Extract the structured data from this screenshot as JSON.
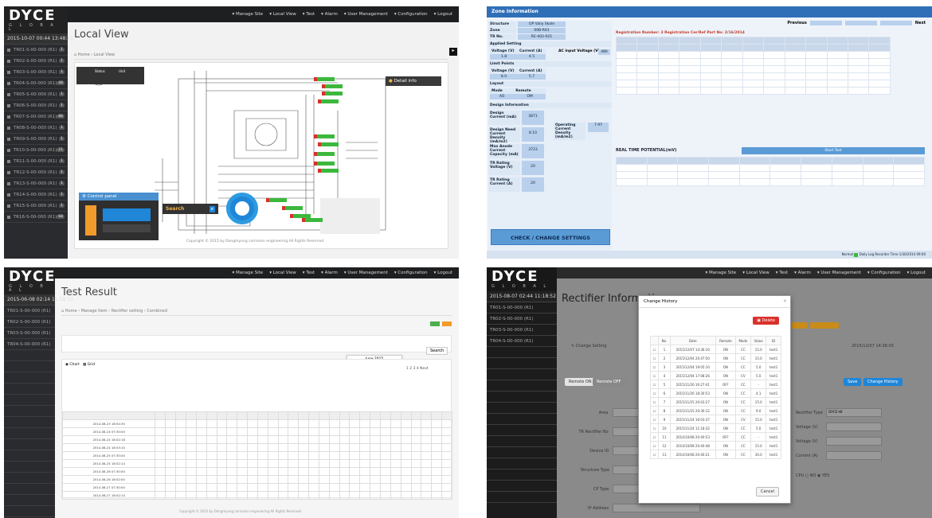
{
  "brand": {
    "name": "DYCE",
    "tagline": "G L O B A L"
  },
  "colors": {
    "sidebar": "#2a2b2e",
    "accent_blue": "#1f86d8",
    "panel_blue": "#5b9bd5",
    "orange": "#f29b2b",
    "red": "#d9302a",
    "green": "#4cae4c",
    "marker_green": "#3cb83c"
  },
  "p1": {
    "clock": "2015-10-07 00:44 13:48:21",
    "title": "Local View",
    "breadcrumb": [
      "Home",
      "Local View"
    ],
    "nav": [
      "Manage Site",
      "Local View",
      "Test",
      "Alarm",
      "User Management",
      "Configuration",
      "Logout"
    ],
    "sidebar": [
      {
        "label": "TR01-S-00-000 (R1)",
        "badge": "1"
      },
      {
        "label": "TR02-S-00-000 (R1)",
        "badge": "1"
      },
      {
        "label": "TR03-S-00-000 (R1)",
        "badge": "1"
      },
      {
        "label": "TR04-S-00-000 (R1)",
        "badge": "48"
      },
      {
        "label": "TR05-S-00-000 (R1)",
        "badge": "1"
      },
      {
        "label": "TR06-S-00-000 (R1)",
        "badge": "1"
      },
      {
        "label": "TR07-S-00-000 (R1)",
        "badge": "88"
      },
      {
        "label": "TR08-S-00-000 (R1)",
        "badge": "1"
      },
      {
        "label": "TR09-S-00-000 (R1)",
        "badge": "1"
      },
      {
        "label": "TR10-S-00-000 (R1)",
        "badge": "21"
      },
      {
        "label": "TR11-S-00-000 (R1)",
        "badge": "1"
      },
      {
        "label": "TR12-S-00-000 (R1)",
        "badge": "1"
      },
      {
        "label": "TR13-S-00-000 (R1)",
        "badge": "1"
      },
      {
        "label": "TR14-S-00-000 (R1)",
        "badge": "1"
      },
      {
        "label": "TR15-S-00-000 (R1)",
        "badge": "1"
      },
      {
        "label": "TR16-S-00-000 (R1)",
        "badge": "68"
      }
    ],
    "detail": "Detail info",
    "control": "Control panel",
    "search": "Search",
    "footer": "Copyright © 2015 by Dongmyung corrosion engineering All Rights Reserved",
    "map_head": {
      "a": "Status",
      "b": "Unit"
    }
  },
  "p2": {
    "title": "Zone Information",
    "prev": "Previous",
    "next": "Next",
    "left_rows": [
      {
        "k": "Structure",
        "v": "OP Valiy Skale"
      },
      {
        "k": "Zone",
        "v": "00B-R01"
      },
      {
        "k": "TR No.",
        "v": "RE-402-021"
      }
    ],
    "applied": "Applied Setting",
    "voltage": "Voltage (V)",
    "current": "Current (A)",
    "v1": "1.8",
    "c1": "4.5",
    "ac": "AC input Voltage (V)",
    "acv": "480",
    "limit": "Limit Points",
    "v2": "8.0",
    "c2": "5.7",
    "layout": "Layout",
    "mode": "Mode",
    "remote": "Remote",
    "m1": "AO",
    "m2": "OM",
    "design": "Design Information",
    "d": [
      {
        "k": "Design Current (mA)",
        "v": "3871"
      },
      {
        "k": "Design Need Current Density (mA/m2)",
        "v": "8.10"
      },
      {
        "k": "Max Anode Current Capacity (mA)",
        "v": "3723"
      },
      {
        "k": "TR Rating Voltage (V)",
        "v": "20"
      },
      {
        "k": "TR Rating Current (A)",
        "v": "20"
      }
    ],
    "op": "Operating Current Density (mA/m2)",
    "opv": "7.97",
    "check": "CHECK / CHANGE SETTINGS",
    "reg": "Registration Number: 3  Registration Cer/Ref Part No: 2/16/2014",
    "rt_title": "REAL TIME POTENTIAL(mV)",
    "start": "Start Test",
    "status": [
      "Normal",
      "Daily Log Recorder Time",
      "1/30/2014 09:00"
    ]
  },
  "p3": {
    "clock": "2015-06-08 02:14 11:18:12",
    "title": "Test Result",
    "breadcrumb": [
      "Home",
      "Manage Item",
      "Rectifier setting",
      "Combined"
    ],
    "search": "Search",
    "month": "June 2015",
    "days": [
      "Su",
      "Mo",
      "Tu",
      "We",
      "Th",
      "Fr",
      "Sa"
    ],
    "rows": [
      "2014-08-23 18:54:30",
      "2014-08-24 07:30:00",
      "2014-08-24 18:02:18",
      "2014-08-24 18:53:10",
      "2014-08-25 07:30:00",
      "2014-08-25 18:02:14",
      "2014-08-26 07:30:00",
      "2014-08-26 18:02:00",
      "2014-08-27 07:30:00",
      "2014-08-27 18:02:14"
    ],
    "footer": "Copyright © 2015 by Dongmyung corrosion engineering All Rights Reserved"
  },
  "p4": {
    "clock": "2015-08-07 02:44 11:18:52",
    "title": "Rectifier Information",
    "modal": "Change History",
    "delete": "Delete",
    "cancel": "Cancel",
    "cols": [
      "",
      "No.",
      "Date",
      "Remote",
      "Mode",
      "Value",
      "ID"
    ],
    "hist": [
      [
        "1",
        "2015/12/07 14:36:10",
        "ON",
        "CC",
        "15.0",
        "test1"
      ],
      [
        "2",
        "2015/12/04 20:47:50",
        "ON",
        "CC",
        "15.0",
        "test1"
      ],
      [
        "3",
        "2015/12/04 19:05:10",
        "ON",
        "CC",
        "5.0",
        "test1"
      ],
      [
        "4",
        "2015/12/04 17:08:26",
        "ON",
        "CV",
        "5.0",
        "test1"
      ],
      [
        "5",
        "2015/11/26 16:27:41",
        "OFF",
        "CC",
        "-",
        "test1"
      ],
      [
        "6",
        "2015/11/26 18:30:53",
        "ON",
        "CC",
        "4.1",
        "test1"
      ],
      [
        "7",
        "2015/11/25 20:03:27",
        "ON",
        "CC",
        "15.0",
        "test1"
      ],
      [
        "8",
        "2015/11/25 20:30:12",
        "ON",
        "CC",
        "9.0",
        "test1"
      ],
      [
        "9",
        "2015/11/24 16:03:37",
        "ON",
        "CV",
        "15.0",
        "test1"
      ],
      [
        "10",
        "2015/11/24 11:18:32",
        "ON",
        "CC",
        "5.0",
        "test1"
      ],
      [
        "11",
        "2014/10/08 20:40:53",
        "OFF",
        "CC",
        "-",
        "test1"
      ],
      [
        "12",
        "2014/10/08 20:40:48",
        "ON",
        "CC",
        "15.0",
        "test1"
      ],
      [
        "13",
        "2014/10/08 20:40:21",
        "ON",
        "CC",
        "30.0",
        "test1"
      ]
    ],
    "change": "Change Setting",
    "remote_on": "Remote ON",
    "remote_off": "Remote OFF",
    "save": "Save",
    "change_history": "Change History",
    "fields": [
      "Area",
      "TR Rectifier No",
      "Device ID",
      "Structure Type",
      "CP Type",
      "IP Address"
    ],
    "rfields": [
      "Rectifier Type",
      "Voltage (V)",
      "Voltage (V)",
      "Current (A)"
    ],
    "rtype": "DYCE-W",
    "cpu": "CPU",
    "no": "NO",
    "yes": "YES",
    "date": "2015/12/07 14:36:03",
    "side": [
      "TR01-S-00-000 (R1)",
      "TR02-S-00-000 (R1)",
      "TR03-S-00-000 (R1)",
      "TR04-S-00-000 (R1)"
    ]
  }
}
